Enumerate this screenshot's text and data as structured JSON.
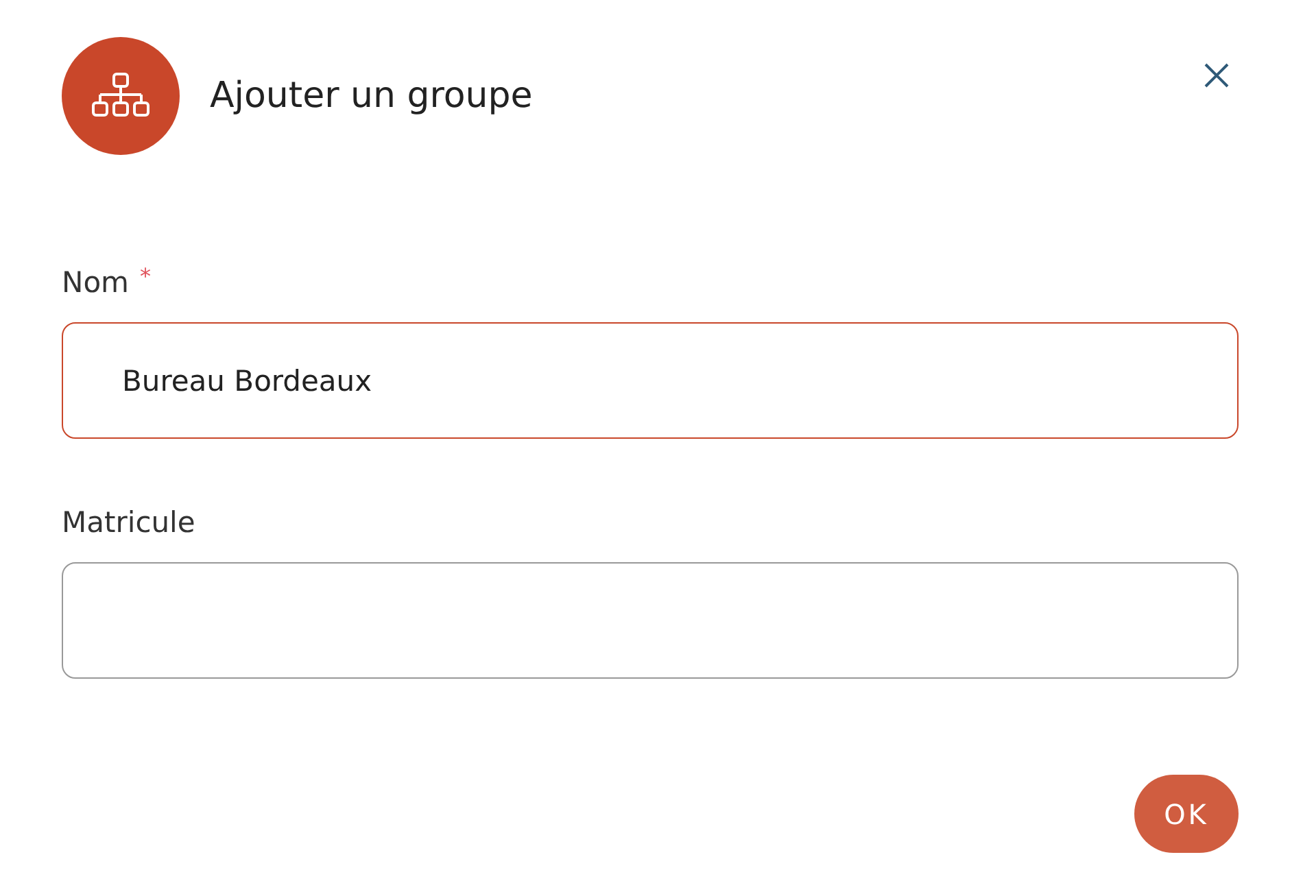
{
  "dialog": {
    "title": "Ajouter un groupe"
  },
  "fields": [
    {
      "label": "Nom",
      "required_mark": "*",
      "value": "Bureau Bordeaux",
      "focused": true
    },
    {
      "label": "Matricule",
      "focused": false
    }
  ],
  "buttons": [
    {
      "label": "OK"
    }
  ]
}
